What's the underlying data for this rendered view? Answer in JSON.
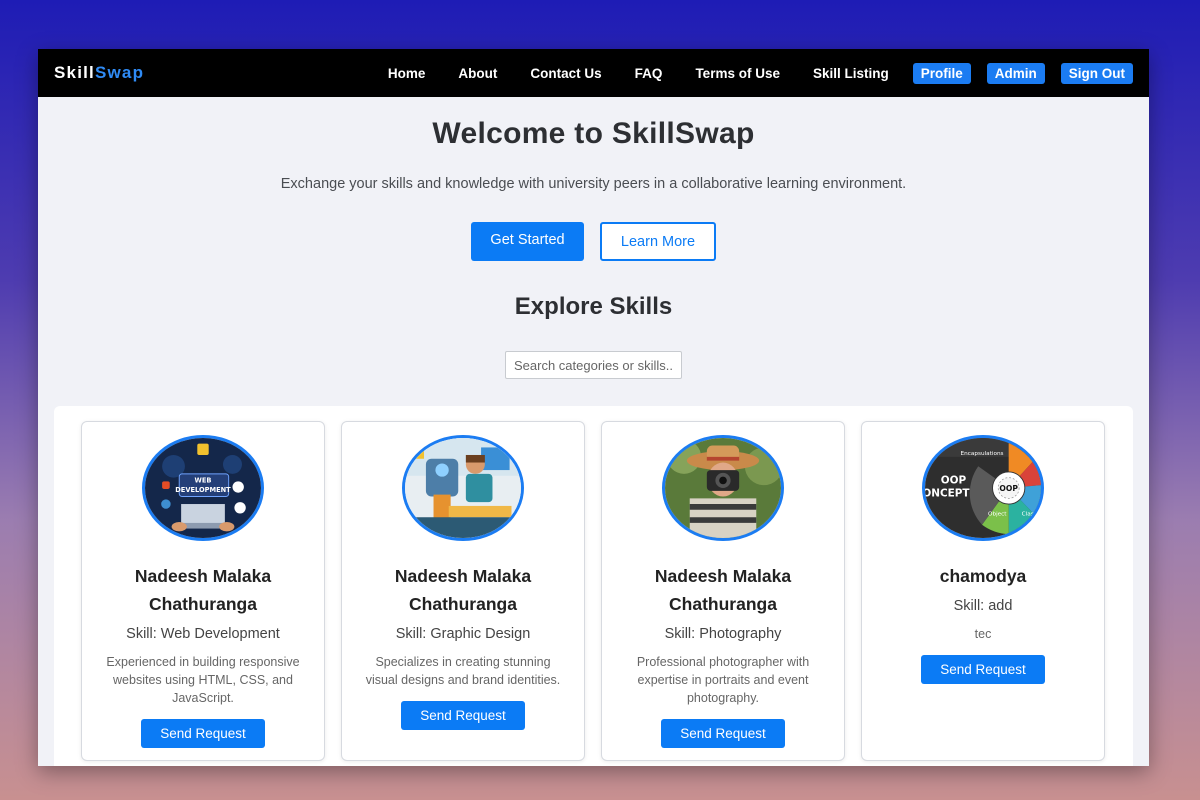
{
  "nav": {
    "brand_part1": "Skill",
    "brand_part2": "Swap",
    "links": [
      "Home",
      "About",
      "Contact Us",
      "FAQ",
      "Terms of Use",
      "Skill Listing"
    ],
    "buttons": [
      "Profile",
      "Admin",
      "Sign Out"
    ]
  },
  "hero": {
    "title": "Welcome to SkillSwap",
    "tagline": "Exchange your skills and knowledge with university peers in a collaborative learning environment.",
    "primary_button": "Get Started",
    "secondary_button": "Learn More"
  },
  "explore": {
    "title": "Explore Skills",
    "search_placeholder": "Search categories or skills.."
  },
  "cards": [
    {
      "name": "Nadeesh Malaka Chathuranga",
      "skill": "Skill: Web Development",
      "description": "Experienced in building responsive websites using HTML, CSS, and JavaScript.",
      "button": "Send Request",
      "image_labels": [
        "WEB",
        "DEVELOPMENT"
      ]
    },
    {
      "name": "Nadeesh Malaka Chathuranga",
      "skill": "Skill: Graphic Design",
      "description": "Specializes in creating stunning visual designs and brand identities.",
      "button": "Send Request"
    },
    {
      "name": "Nadeesh Malaka Chathuranga",
      "skill": "Skill: Photography",
      "description": "Professional photographer with expertise in portraits and event photography.",
      "button": "Send Request"
    },
    {
      "name": "chamodya",
      "skill": "Skill: add",
      "description": "tec",
      "button": "Send Request",
      "image_labels": [
        "OOP",
        "ONCEPT",
        "Encapsulations",
        "OOP",
        "Object",
        "Clas"
      ]
    }
  ],
  "colors": {
    "accent": "#0b7bf5",
    "navbar_bg": "#000000",
    "page_bg": "#f1f2f7"
  }
}
